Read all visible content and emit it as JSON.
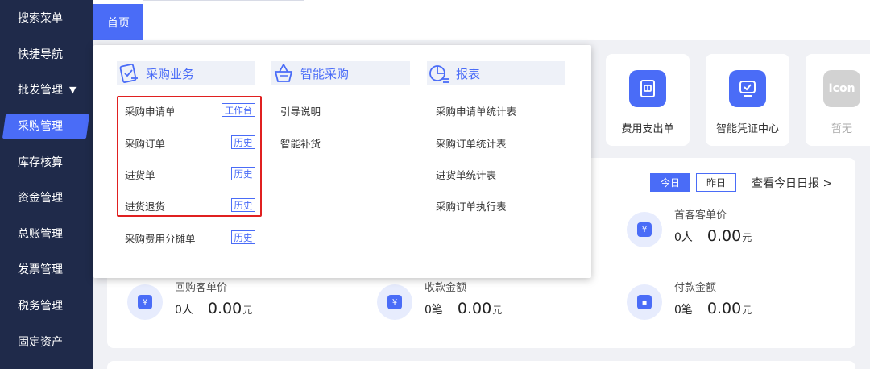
{
  "sidebar": {
    "items": [
      {
        "label": "搜索菜单"
      },
      {
        "label": "快捷导航"
      },
      {
        "label": "批发管理",
        "caret": "▼"
      },
      {
        "label": "采购管理"
      },
      {
        "label": "库存核算"
      },
      {
        "label": "资金管理"
      },
      {
        "label": "总账管理"
      },
      {
        "label": "发票管理"
      },
      {
        "label": "税务管理"
      },
      {
        "label": "固定资产"
      }
    ]
  },
  "topbar": {
    "home_tab": "首页"
  },
  "quick_access": [
    {
      "label": "费用支出单",
      "icon": "receipt-icon",
      "color": "#4a6cf7"
    },
    {
      "label": "智能凭证中心",
      "icon": "voucher-monitor-icon",
      "color": "#4a6cf7"
    },
    {
      "label": "暂无",
      "icon_text": "Icon",
      "color": "#c9c9c9"
    }
  ],
  "stats_panel": {
    "today_label": "今日",
    "yesterday_label": "昨日",
    "view_report": "查看今日日报 >",
    "items": [
      {
        "title": "首客客单价",
        "count": "0人",
        "amount": "0.00",
        "unit": "元"
      },
      {
        "title": "回购客单价",
        "count": "0人",
        "amount": "0.00",
        "unit": "元"
      },
      {
        "title": "收款金额",
        "count": "0笔",
        "amount": "0.00",
        "unit": "元"
      },
      {
        "title": "付款金额",
        "count": "0笔",
        "amount": "0.00",
        "unit": "元"
      }
    ]
  },
  "menu": {
    "columns": [
      {
        "title": "采购业务",
        "icon": "purchase-doc-icon",
        "links": [
          {
            "label": "采购申请单",
            "tag": "工作台"
          },
          {
            "label": "采购订单",
            "tag": "历史"
          },
          {
            "label": "进货单",
            "tag": "历史"
          },
          {
            "label": "进货退货",
            "tag": "历史"
          },
          {
            "label": "采购费用分摊单",
            "tag": "历史"
          }
        ]
      },
      {
        "title": "智能采购",
        "icon": "basket-icon",
        "links": [
          {
            "label": "引导说明"
          },
          {
            "label": "智能补货"
          }
        ]
      },
      {
        "title": "报表",
        "icon": "report-icon",
        "links": [
          {
            "label": "采购申请单统计表"
          },
          {
            "label": "采购订单统计表"
          },
          {
            "label": "进货单统计表"
          },
          {
            "label": "采购订单执行表"
          }
        ]
      }
    ],
    "highlight_color": "#e02020"
  },
  "colors": {
    "accent": "#4a6cf7",
    "sidebar_bg": "#1f2a4a"
  }
}
